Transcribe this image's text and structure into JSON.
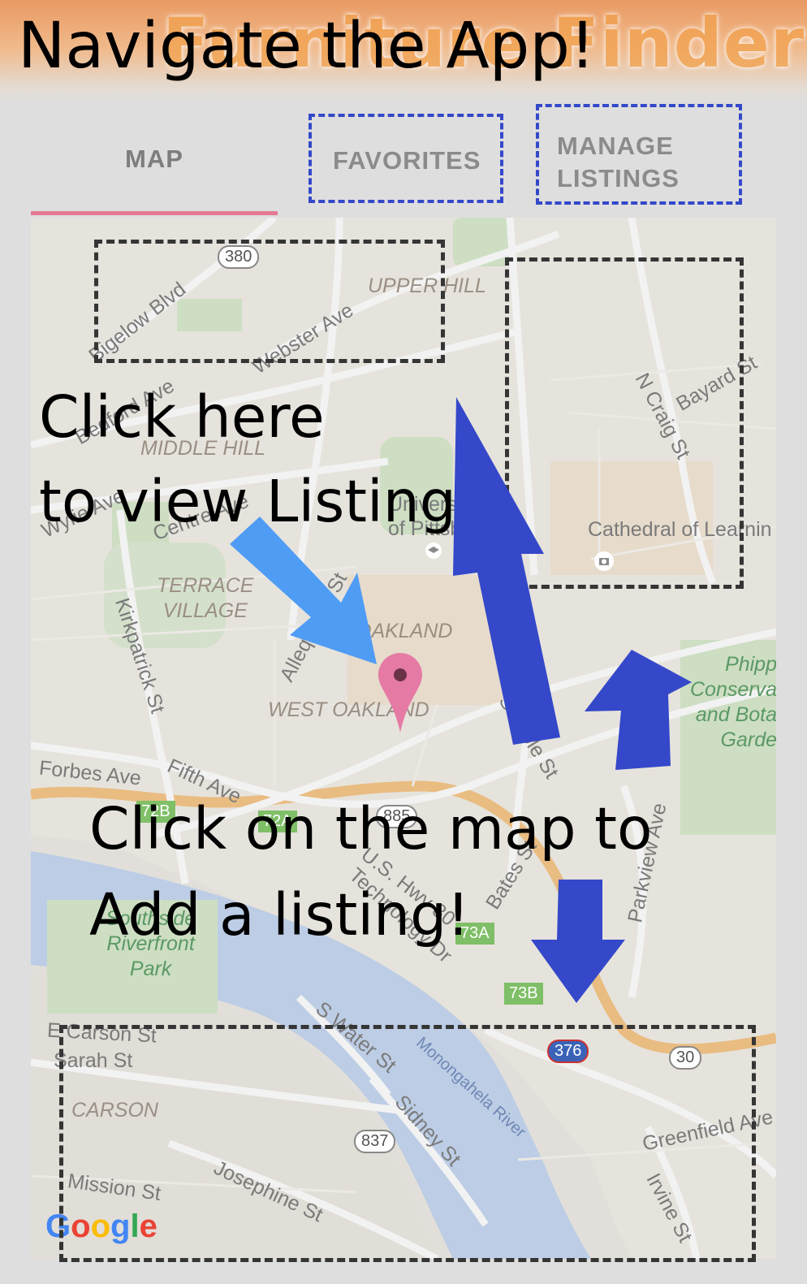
{
  "app": {
    "brand": "Furniture Finder",
    "overlay_title": "Navigate the App!"
  },
  "tabs": [
    {
      "label": "MAP",
      "active": true
    },
    {
      "label": "FAVORITES",
      "active": false
    },
    {
      "label_line1": "MANAGE",
      "label_line2": "LISTINGS",
      "active": false
    }
  ],
  "annotations": {
    "view_listing_line1": "Click here",
    "view_listing_line2": "to view Listing",
    "add_listing_line1": "Click on the map to",
    "add_listing_line2": "Add a listing!"
  },
  "map": {
    "streets": [
      "Bigelow Blvd",
      "Webster Ave",
      "Bedford Ave",
      "Wylie Ave",
      "Centre Ave",
      "N Craig St",
      "Bayard St",
      "Kirkpatrick St",
      "Allequippa St",
      "Forbes Ave",
      "Fifth Ave",
      "Semple St",
      "Bates St",
      "Parkview Ave",
      "Technology Dr",
      "U.S. Hwy 30",
      "E Carson St",
      "Sarah St",
      "S Water St",
      "Sidney St",
      "Josephine St",
      "Mission St",
      "Greenfield Ave",
      "Irvine St",
      "Monongahela River"
    ],
    "areas": [
      "UPPER HILL",
      "MIDDLE HILL",
      "TERRACE VILLAGE",
      "OAKLAND",
      "WEST OAKLAND",
      "CARSON"
    ],
    "places": [
      "Univ. of Pittsb",
      "Cathedral of Learnin",
      "Phipps Conservatory and Botanical Garden",
      "Southside Riverfront Park"
    ],
    "place_lines": {
      "univ1": "Univers",
      "univ2": "of Pittsb",
      "phipps1": "Phipp",
      "phipps2": "Conserva",
      "phipps3": "and Bota",
      "phipps4": "Garde",
      "park1": "Southside",
      "park2": "Riverfront",
      "park3": "Park",
      "terrace1": "TERRACE",
      "terrace2": "VILLAGE"
    },
    "shields": [
      "380",
      "885",
      "376",
      "30",
      "837"
    ],
    "exits": [
      "72B",
      "72A",
      "73A",
      "73B"
    ],
    "attribution": "Google"
  },
  "colors": {
    "accent_tab": "#e37b96",
    "annotation_blue": "#3448c9",
    "arrow_light": "#4f9cf5",
    "marker": "#e57aa5",
    "water": "#a8c3ea",
    "park": "#c4dfb3",
    "highway": "#f1a84a"
  }
}
